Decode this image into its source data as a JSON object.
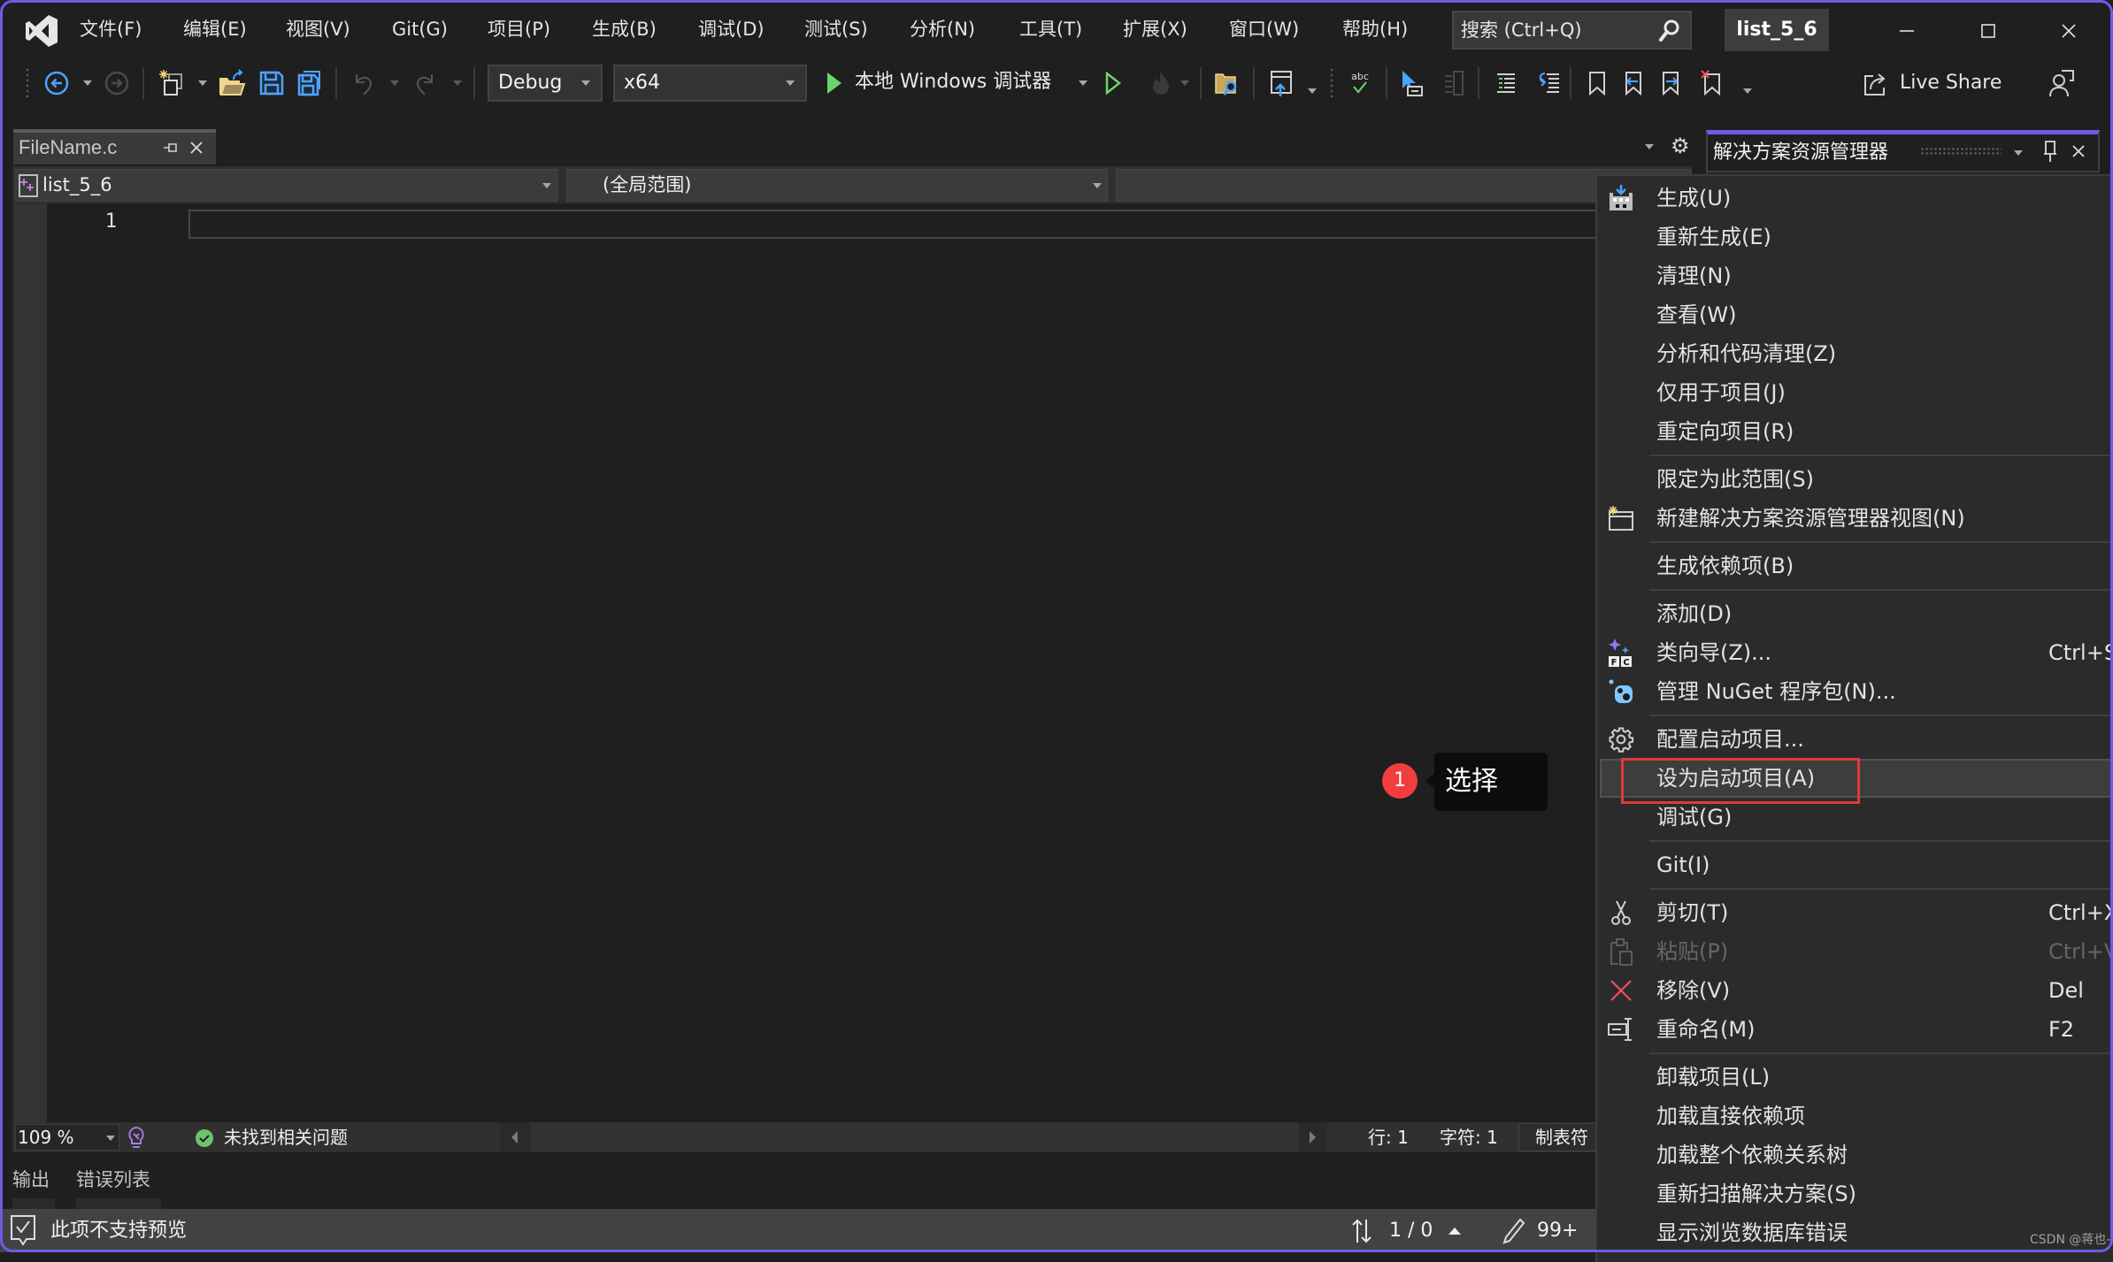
{
  "app": {
    "title": "list_5_6",
    "accent_color": "#6b5ce7"
  },
  "menubar": {
    "items": [
      "文件(F)",
      "编辑(E)",
      "视图(V)",
      "Git(G)",
      "项目(P)",
      "生成(B)",
      "调试(D)",
      "测试(S)",
      "分析(N)",
      "工具(T)",
      "扩展(X)",
      "窗口(W)",
      "帮助(H)"
    ]
  },
  "search": {
    "placeholder": "搜索 (Ctrl+Q)"
  },
  "toolbar": {
    "configuration": "Debug",
    "platform": "x64",
    "start_debugging_label": "本地 Windows 调试器",
    "live_share_label": "Live Share"
  },
  "editor": {
    "tab": {
      "label": "FileName.c"
    },
    "navigation": {
      "project": "list_5_6",
      "scope": "(全局范围)",
      "member": ""
    },
    "lines": [
      {
        "number": "1",
        "text": ""
      }
    ]
  },
  "editor_status": {
    "zoom": "109 %",
    "issues": "未找到相关问题",
    "line": "行: 1",
    "column": "字符: 1",
    "indentation": "制表符"
  },
  "tool_tabs": [
    "输出",
    "错误列表"
  ],
  "status_bar": {
    "message": "此项不支持预览",
    "sync_counts": "1 / 0",
    "pending_edits": "99+"
  },
  "solution_explorer": {
    "title": "解决方案资源管理器"
  },
  "context_menu": {
    "items": [
      {
        "label": "生成(U)",
        "icon": "build-icon"
      },
      {
        "label": "重新生成(E)"
      },
      {
        "label": "清理(N)"
      },
      {
        "label": "查看(W)"
      },
      {
        "label": "分析和代码清理(Z)"
      },
      {
        "label": "仅用于项目(J)"
      },
      {
        "label": "重定向项目(R)"
      },
      {
        "label": "限定为此范围(S)"
      },
      {
        "label": "新建解决方案资源管理器视图(N)",
        "icon": "new-view-icon"
      },
      {
        "label": "生成依赖项(B)"
      },
      {
        "label": "添加(D)"
      },
      {
        "label": "类向导(Z)...",
        "icon": "class-wizard-icon",
        "shortcut": "Ctrl+S"
      },
      {
        "label": "管理 NuGet 程序包(N)...",
        "icon": "nuget-icon"
      },
      {
        "label": "配置启动项目...",
        "icon": "gear-icon"
      },
      {
        "label": "设为启动项目(A)",
        "highlighted": true
      },
      {
        "label": "调试(G)"
      },
      {
        "label": "Git(I)"
      },
      {
        "label": "剪切(T)",
        "icon": "scissors-icon",
        "shortcut": "Ctrl+X"
      },
      {
        "label": "粘贴(P)",
        "icon": "paste-icon",
        "shortcut": "Ctrl+V",
        "disabled": true
      },
      {
        "label": "移除(V)",
        "icon": "remove-icon",
        "shortcut": "Del"
      },
      {
        "label": "重命名(M)",
        "icon": "rename-icon",
        "shortcut": "F2"
      },
      {
        "label": "卸载项目(L)"
      },
      {
        "label": "加载直接依赖项"
      },
      {
        "label": "加载整个依赖关系树"
      },
      {
        "label": "重新扫描解决方案(S)"
      },
      {
        "label": "显示浏览数据库错误"
      }
    ],
    "separators_after": [
      6,
      8,
      9,
      12,
      15,
      16,
      20
    ],
    "highlighted_index": 14
  },
  "annotation": {
    "step": "1",
    "label": "选择",
    "badge_color": "#f03d3d",
    "highlight_color": "#e5383b"
  },
  "watermark": "CSDN @蒋也-"
}
